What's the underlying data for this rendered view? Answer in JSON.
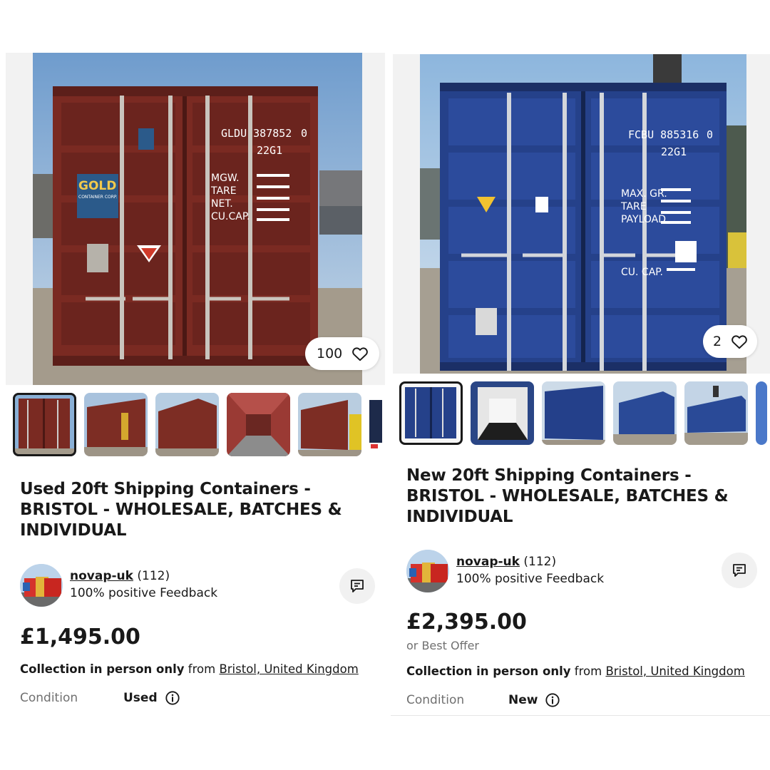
{
  "listings": [
    {
      "watch_count": "100",
      "title": "Used 20ft Shipping Containers - BRISTOL - WHOLESALE, BATCHES & INDIVIDUAL",
      "seller": {
        "name": "novap-uk",
        "rating": "(112)",
        "feedback": "100% positive Feedback"
      },
      "price": "£1,495.00",
      "collection": {
        "bold": "Collection in person only",
        "from": "from",
        "location": "Bristol, United Kingdom"
      },
      "condition": {
        "label": "Condition",
        "value": "Used"
      },
      "photo": {
        "container_id": "GLDU 387852",
        "check_digit": "0",
        "type_code": "22G1",
        "specs_labels": [
          "MGW.",
          "TARE",
          "NET.",
          "CU.CAP."
        ],
        "brand": "GOLD",
        "brand_sub": "CONTAINER CORP.",
        "color": "#7a2a22"
      },
      "thumbnails": [
        "front",
        "side-logo",
        "side",
        "interior",
        "side-forklift",
        "partial"
      ]
    },
    {
      "watch_count": "2",
      "title": "New 20ft Shipping Containers - BRISTOL - WHOLESALE, BATCHES & INDIVIDUAL",
      "seller": {
        "name": "novap-uk",
        "rating": "(112)",
        "feedback": "100% positive Feedback"
      },
      "price": "£2,395.00",
      "best_offer": "or Best Offer",
      "collection": {
        "bold": "Collection in person only",
        "from": "from",
        "location": "Bristol, United Kingdom"
      },
      "condition": {
        "label": "Condition",
        "value": "New"
      },
      "photo": {
        "container_id": "FCBU 885316",
        "check_digit": "0",
        "type_code": "22G1",
        "specs_labels": [
          "MAX. GR.",
          "TARE",
          "PAYLOAD"
        ],
        "cu_cap": "CU. CAP.",
        "color": "#25418a"
      },
      "thumbnails": [
        "front",
        "interior",
        "side",
        "side",
        "side",
        "partial"
      ]
    }
  ]
}
